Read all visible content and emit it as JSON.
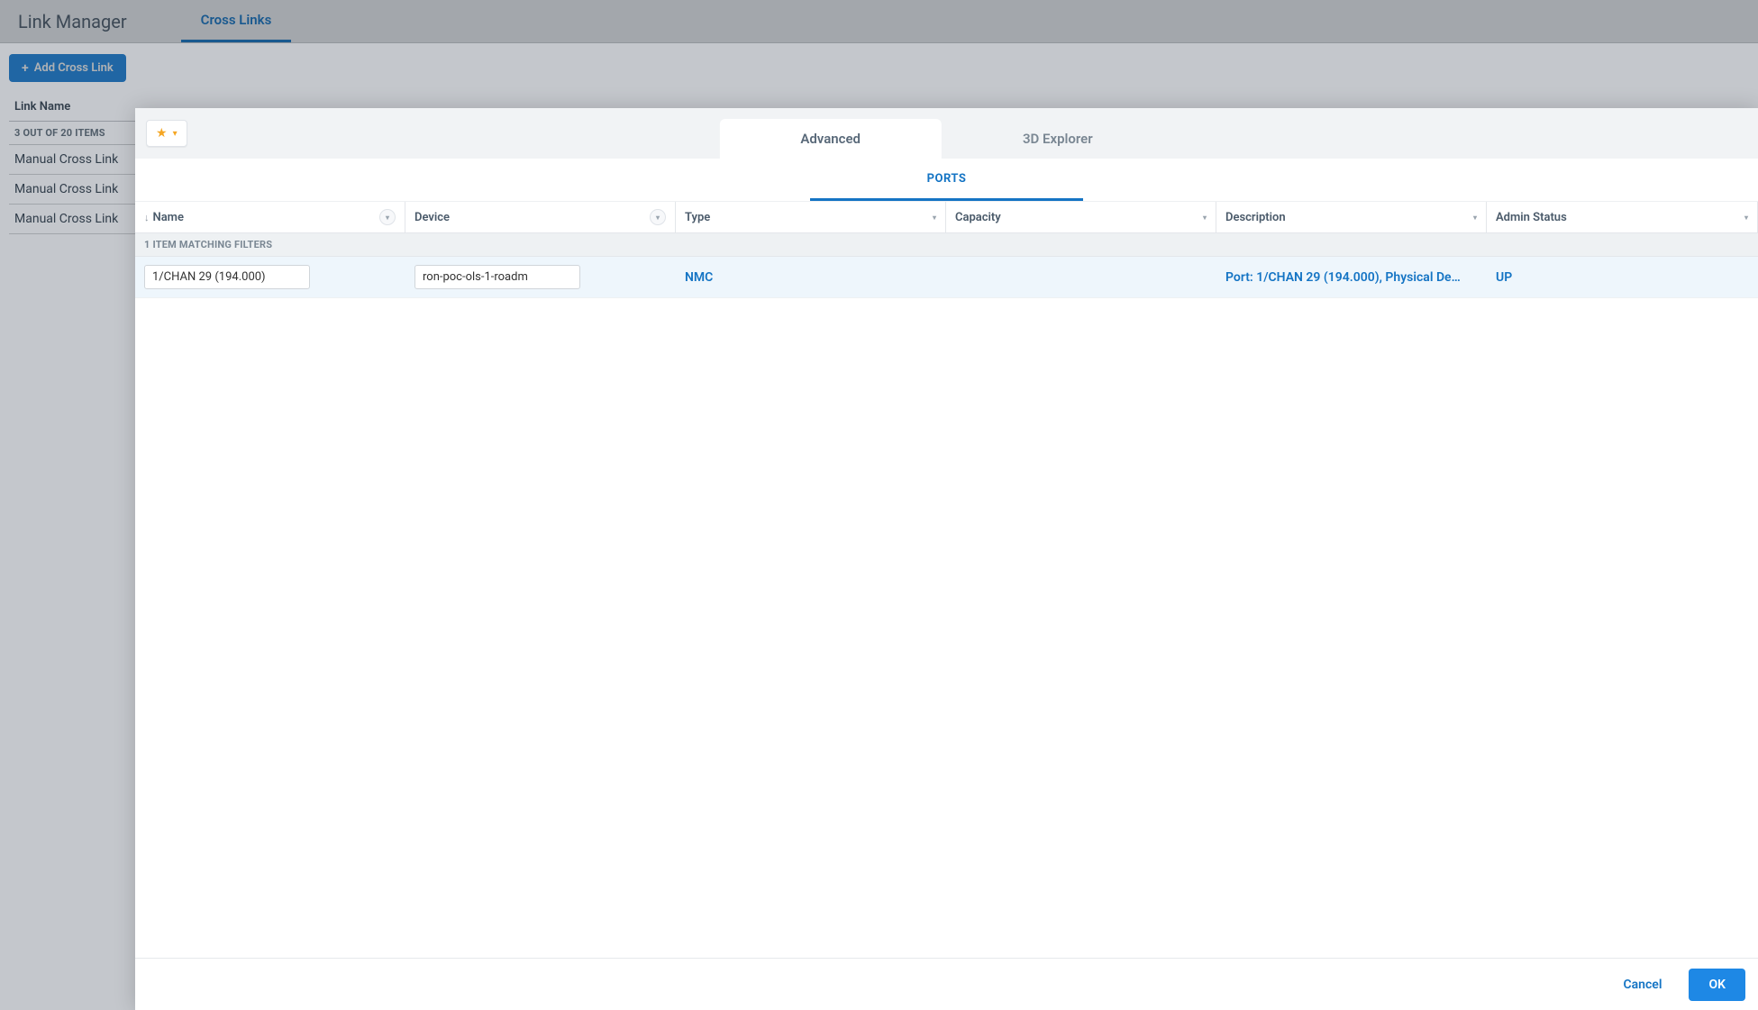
{
  "bg": {
    "title": "Link Manager",
    "active_tab": "Cross Links",
    "add_button": "Add Cross Link",
    "table_header": "Link Name",
    "count_label": "3 OUT OF 20 ITEMS",
    "rows": [
      "Manual Cross Link",
      "Manual Cross Link",
      "Manual Cross Link"
    ]
  },
  "modal": {
    "tabs": {
      "advanced": "Advanced",
      "explorer": "3D Explorer"
    },
    "subtab": "PORTS",
    "columns": {
      "name": "Name",
      "device": "Device",
      "type": "Type",
      "capacity": "Capacity",
      "description": "Description",
      "admin_status": "Admin Status"
    },
    "filter_summary": "1 ITEM MATCHING FILTERS",
    "row": {
      "name_filter": "1/CHAN 29 (194.000)",
      "device_filter": "ron-poc-ols-1-roadm",
      "type": "NMC",
      "capacity": "",
      "description": "Port: 1/CHAN 29 (194.000), Physical De…",
      "admin_status": "UP"
    },
    "footer": {
      "cancel": "Cancel",
      "ok": "OK"
    }
  }
}
